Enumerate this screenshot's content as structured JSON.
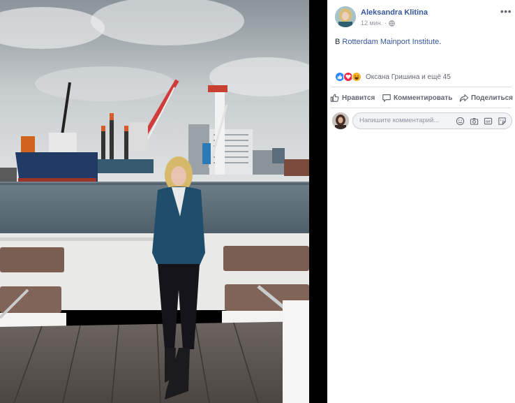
{
  "post": {
    "author": "Aleksandra Klitina",
    "timestamp": "12 мин.",
    "privacy_icon": "globe-icon",
    "more_label": "•••",
    "text_prefix": "В ",
    "place_link": "Rotterdam Mainport Institute",
    "text_suffix": "."
  },
  "reactions": {
    "icons": [
      "like-reaction-icon",
      "love-reaction-icon",
      "haha-reaction-icon"
    ],
    "summary": "Оксана Гришина и ещё 45"
  },
  "actions": {
    "like_label": "Нравится",
    "comment_label": "Комментировать",
    "share_label": "Поделиться"
  },
  "comment": {
    "placeholder": "Напишите комментарий...",
    "tool_icons": [
      "emoji-icon",
      "camera-icon",
      "gif-icon",
      "sticker-icon"
    ]
  },
  "photo": {
    "description_icon": "harbor-photo",
    "gif_text": "GIF"
  },
  "colors": {
    "link": "#365899",
    "muted": "#606770",
    "like": "#2d88ff",
    "love": "#f0284a",
    "haha": "#f7b125"
  }
}
